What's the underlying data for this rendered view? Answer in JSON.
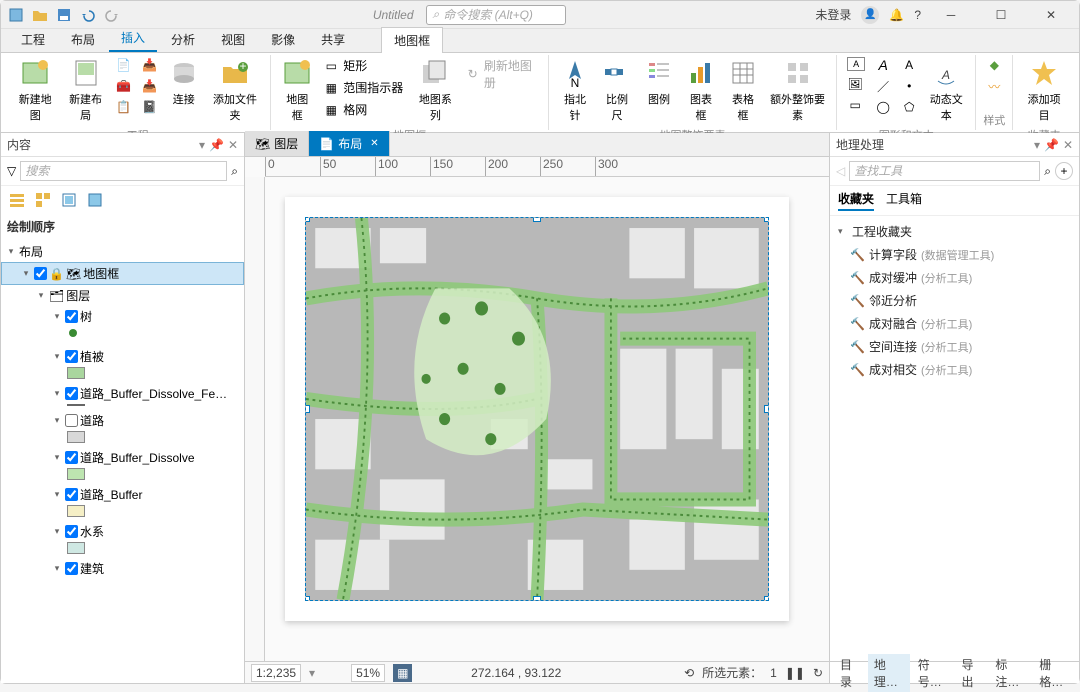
{
  "title": "Untitled",
  "cmd_search_placeholder": "命令搜索 (Alt+Q)",
  "login_status": "未登录",
  "ribbon": {
    "tabs": [
      "工程",
      "布局",
      "插入",
      "分析",
      "视图",
      "影像",
      "共享"
    ],
    "context_tab": "地图框",
    "active_index": 2,
    "groups": {
      "project": {
        "new_map": "新建地图",
        "new_layout": "新建布局",
        "connect": "连接",
        "add_folder": "添加文件夹",
        "label": "工程"
      },
      "mapframe": {
        "map_frame": "地图框",
        "rect": "矩形",
        "extent_indicator": "范围指示器",
        "grid": "格网",
        "map_series": "地图系列",
        "refresh": "刷新地图册",
        "label": "地图框"
      },
      "surrounds": {
        "north_arrow": "指北针",
        "scale_bar": "比例尺",
        "legend": "图例",
        "chart_frame": "图表框",
        "table_frame": "表格框",
        "additional": "额外整饰要素",
        "label": "地图整饰要素"
      },
      "graphics": {
        "dynamic_text": "动态文本",
        "label": "图形和文本"
      },
      "styles": {
        "label": "样式"
      },
      "favorites": {
        "add_item": "添加项目",
        "label": "收藏夹"
      }
    }
  },
  "contents": {
    "title": "内容",
    "search_placeholder": "搜索",
    "section": "绘制顺序",
    "root": "布局",
    "map_frame": "地图框",
    "layer_group": "图层",
    "layers": [
      {
        "name": "树",
        "checked": true,
        "symbol_color": "#3a8b33",
        "symbol_type": "point"
      },
      {
        "name": "植被",
        "checked": true,
        "symbol_color": "#a9d69e",
        "symbol_type": "fill"
      },
      {
        "name": "道路_Buffer_Dissolve_FeatureTo",
        "checked": true,
        "symbol_color": "#666",
        "symbol_type": "line"
      },
      {
        "name": "道路",
        "checked": false,
        "symbol_color": "#d8d8d8",
        "symbol_type": "fill"
      },
      {
        "name": "道路_Buffer_Dissolve",
        "checked": true,
        "symbol_color": "#bde5b0",
        "symbol_type": "fill"
      },
      {
        "name": "道路_Buffer",
        "checked": true,
        "symbol_color": "#f5efc6",
        "symbol_type": "fill"
      },
      {
        "name": "水系",
        "checked": true,
        "symbol_color": "#cfe8e3",
        "symbol_type": "fill"
      },
      {
        "name": "建筑",
        "checked": true,
        "symbol_color": "#e8e8e8",
        "symbol_type": "fill"
      }
    ]
  },
  "center": {
    "tabs": [
      {
        "label": "图层",
        "active": false
      },
      {
        "label": "布局",
        "active": true
      }
    ],
    "ruler_ticks": [
      "0",
      "50",
      "100",
      "150",
      "200",
      "250",
      "300"
    ],
    "status": {
      "scale": "1:2,235",
      "zoom": "51%",
      "coords": "272.164 , 93.122",
      "sel_label": "所选元素：",
      "sel_count": "1"
    }
  },
  "gp": {
    "title": "地理处理",
    "search_placeholder": "查找工具",
    "tabs": {
      "favorites": "收藏夹",
      "toolbox": "工具箱"
    },
    "fav_group": "工程收藏夹",
    "tools": [
      {
        "name": "计算字段",
        "cat": "(数据管理工具)"
      },
      {
        "name": "成对缓冲",
        "cat": "(分析工具)"
      },
      {
        "name": "邻近分析",
        "cat": ""
      },
      {
        "name": "成对融合",
        "cat": "(分析工具)"
      },
      {
        "name": "空间连接",
        "cat": "(分析工具)"
      },
      {
        "name": "成对相交",
        "cat": "(分析工具)"
      }
    ]
  },
  "bottom_tabs": [
    "目录",
    "地理…",
    "符号…",
    "导出",
    "标注…",
    "栅格…"
  ],
  "bottom_active": 1
}
